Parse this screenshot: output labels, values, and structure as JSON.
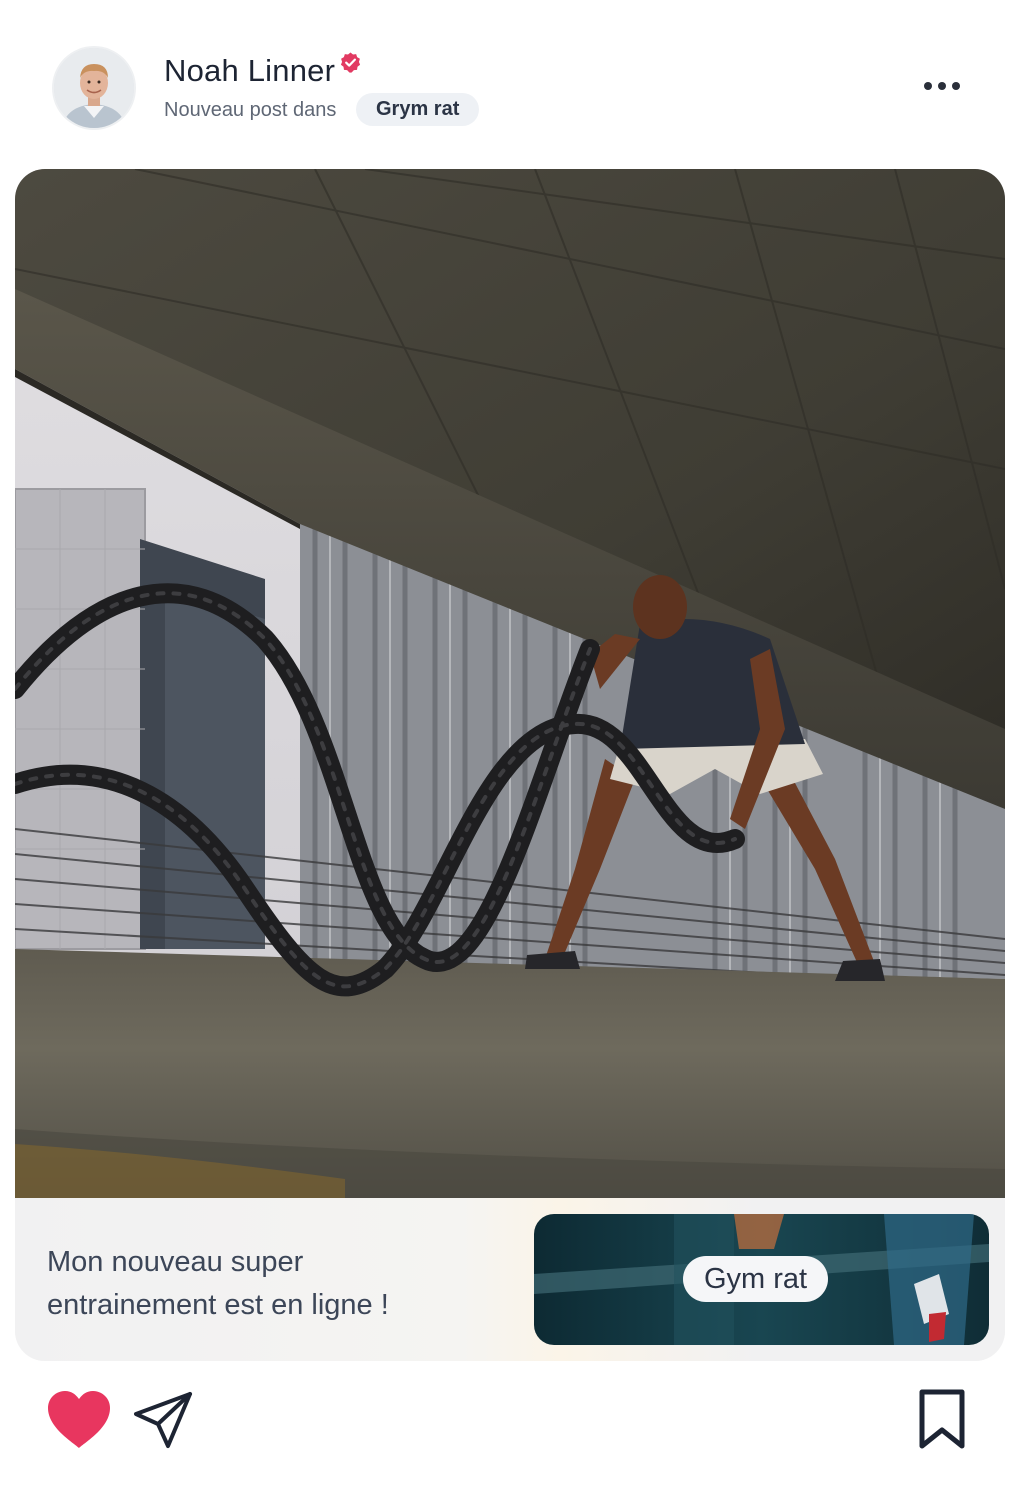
{
  "post": {
    "author_name": "Noah Linner",
    "verified": true,
    "subtitle": "Nouveau post dans",
    "group_chip": "Grym rat",
    "caption_line1": "Mon nouveau super",
    "caption_line2": "entrainement est en ligne !",
    "group_card_label": "Gym rat",
    "liked": true
  },
  "icons": {
    "more": "more-horizontal-icon",
    "verified": "verified-badge-icon",
    "like": "heart-icon",
    "share": "send-icon",
    "save": "bookmark-icon"
  },
  "colors": {
    "like": "#e8365f",
    "verified": "#e23a62",
    "text_primary": "#1d2433",
    "text_secondary": "#5f6775",
    "chip_bg": "#eef1f5"
  }
}
